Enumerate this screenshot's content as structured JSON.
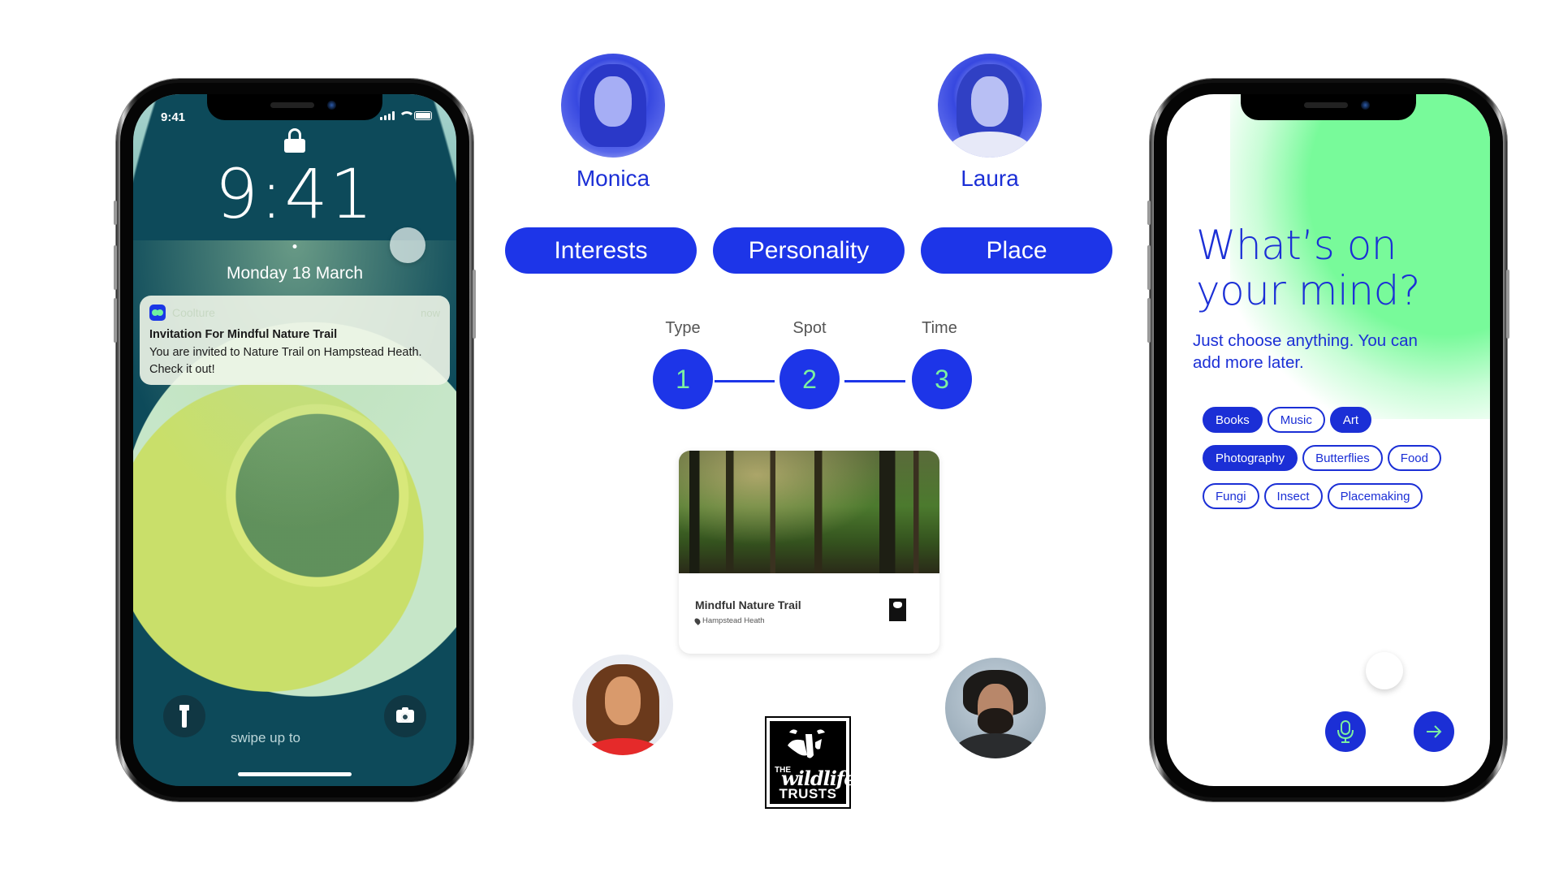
{
  "lock_screen": {
    "status_time": "9:41",
    "clock": "9:41",
    "date": "Monday 18 March",
    "notification": {
      "app_icon": "coolture-app-icon",
      "app_name": "Coolture",
      "time": "now",
      "title": "Invitation For Mindful Nature Trail",
      "body": "You are invited to Nature Trail on Hampstead Heath. Check it out!"
    },
    "swipe_hint": "swipe up to",
    "icons": {
      "lock": "lock-icon",
      "flashlight": "flashlight-icon",
      "camera": "camera-icon",
      "signal": "signal-icon",
      "wifi": "wifi-icon",
      "battery": "battery-icon"
    }
  },
  "people": {
    "top_left": "Monica",
    "top_right": "Laura"
  },
  "tabs": [
    {
      "label": "Interests"
    },
    {
      "label": "Personality"
    },
    {
      "label": "Place"
    }
  ],
  "steps": [
    {
      "label": "Type",
      "number": "1"
    },
    {
      "label": "Spot",
      "number": "2"
    },
    {
      "label": "Time",
      "number": "3"
    }
  ],
  "event_card": {
    "title": "Mindful Nature Trail",
    "location": "Hampstead Heath",
    "logo": "london-wildlife-trust-logo"
  },
  "partner_logo": {
    "the": "THE",
    "wildlife": "wildlife",
    "trusts": "TRUSTS"
  },
  "interests_screen": {
    "title_line1": "What’s on",
    "title_line2": "your mind?",
    "subtitle": "Just choose anything. You can add more later.",
    "chips": [
      [
        {
          "label": "Books",
          "selected": true
        },
        {
          "label": "Music",
          "selected": false
        },
        {
          "label": "Art",
          "selected": true
        }
      ],
      [
        {
          "label": "Photography",
          "selected": true
        },
        {
          "label": "Butterflies",
          "selected": false
        },
        {
          "label": "Food",
          "selected": false
        }
      ],
      [
        {
          "label": "Fungi",
          "selected": false
        },
        {
          "label": "Insect",
          "selected": false
        },
        {
          "label": "Placemaking",
          "selected": false
        }
      ]
    ],
    "buttons": {
      "mic": "microphone-icon",
      "next": "arrow-right-icon"
    }
  },
  "colors": {
    "brand_blue": "#1d35e8",
    "accent_green": "#78fa9a"
  }
}
